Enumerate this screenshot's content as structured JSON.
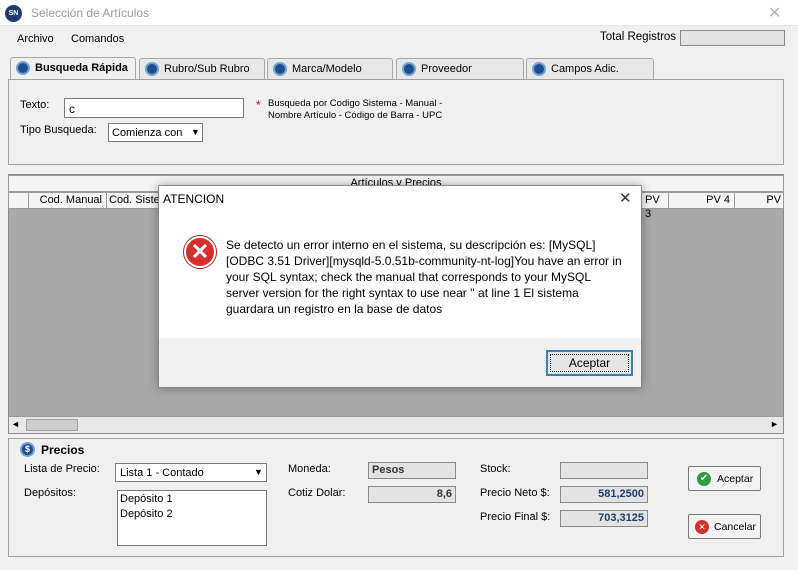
{
  "window": {
    "title": "Selección de Artículos",
    "app_icon_text": "SN"
  },
  "menu": {
    "archivo": "Archivo",
    "comandos": "Comandos"
  },
  "total_registros": {
    "label": "Total Registros",
    "value": ""
  },
  "tabs": [
    {
      "label": "Busqueda Rápida"
    },
    {
      "label": "Rubro/Sub Rubro"
    },
    {
      "label": "Marca/Modelo"
    },
    {
      "label": "Proveedor"
    },
    {
      "label": "Campos Adic."
    }
  ],
  "search": {
    "texto_label": "Texto:",
    "texto_value": "c",
    "tipo_label": "Tipo Busqueda:",
    "tipo_value": "Comienza con",
    "hint_star": "*",
    "hint_line1": "Busqueda por Codigo Sistema - Manual -",
    "hint_line2": "Nombre Artículo - Código de Barra - UPC"
  },
  "grid": {
    "title": "Artículos y Precios",
    "columns": [
      "Cod. Manual",
      "Cod. Siste",
      "PV 3",
      "PV 4",
      "PV"
    ]
  },
  "precios": {
    "title": "Precios",
    "lista_label": "Lista de Precio:",
    "lista_value": "Lista 1 - Contado",
    "depositos_label": "Depósitos:",
    "depositos": [
      "Depósito 1",
      "Depósito 2"
    ],
    "moneda_label": "Moneda:",
    "moneda_value": "Pesos",
    "cotiz_label": "Cotiz Dolar:",
    "cotiz_value": "8,6",
    "stock_label": "Stock:",
    "stock_value": "",
    "neto_label": "Precio Neto $:",
    "neto_value": "581,2500",
    "final_label": "Precio Final $:",
    "final_value": "703,3125",
    "aceptar": "Aceptar",
    "cancelar": "Cancelar"
  },
  "dialog": {
    "title": "ATENCION",
    "message": "Se detecto un error interno en el sistema, su descripción es: [MySQL][ODBC 3.51 Driver][mysqld-5.0.51b-community-nt-log]You have an error in your SQL syntax; check the manual that corresponds to your MySQL server version for the right syntax to use near '' at line 1 El sistema guardara un registro en la base de datos",
    "button": "Aceptar"
  }
}
